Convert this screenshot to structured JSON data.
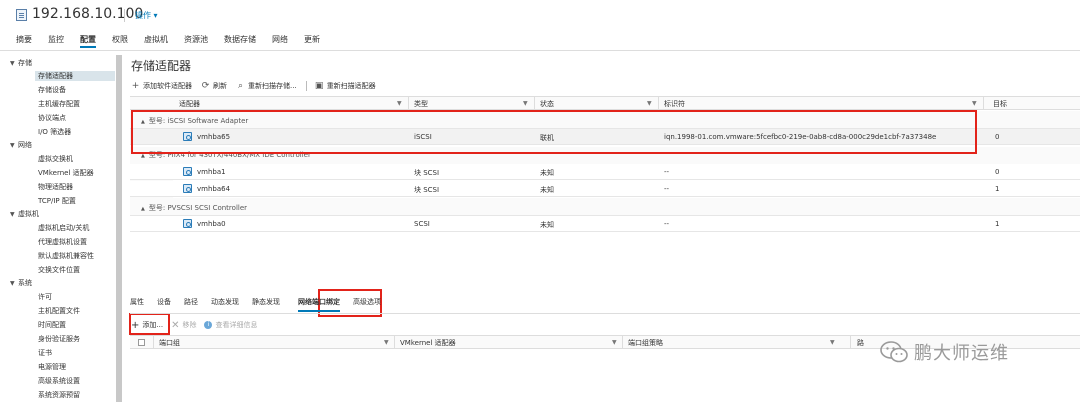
{
  "header": {
    "host": "192.168.10.100",
    "actions_label": "操作 ▾",
    "tabs": [
      "摘要",
      "监控",
      "配置",
      "权限",
      "虚拟机",
      "资源池",
      "数据存储",
      "网络",
      "更新"
    ],
    "active_tab": "配置"
  },
  "sidebar": {
    "groups": [
      {
        "label": "存储",
        "items": [
          "存储适配器",
          "存储设备",
          "主机缓存配置",
          "协议端点",
          "I/O 筛选器"
        ]
      },
      {
        "label": "网络",
        "items": [
          "虚拟交换机",
          "VMkernel 适配器",
          "物理适配器",
          "TCP/IP 配置"
        ]
      },
      {
        "label": "虚拟机",
        "items": [
          "虚拟机启动/关机",
          "代理虚拟机设置",
          "默认虚拟机兼容性",
          "交换文件位置"
        ]
      },
      {
        "label": "系统",
        "items": [
          "许可",
          "主机配置文件",
          "时间配置",
          "身份验证服务",
          "证书",
          "电源管理",
          "高级系统设置",
          "系统资源预留"
        ]
      }
    ],
    "selected": "存储适配器"
  },
  "main": {
    "title": "存储适配器",
    "toolbar": {
      "add_software": "添加软件适配器",
      "refresh": "刷新",
      "rescan_storage": "重新扫描存储...",
      "rescan_adapter": "重新扫描适配器"
    },
    "columns": [
      "适配器",
      "类型",
      "状态",
      "标识符",
      "目标"
    ],
    "groups": [
      {
        "label": "型号: iSCSI Software Adapter",
        "rows": [
          {
            "adapter": "vmhba65",
            "type": "iSCSI",
            "status": "联机",
            "identifier": "iqn.1998-01.com.vmware:5fcefbc0-219e-0ab8-cd8a-000c29de1cbf-7a37348e",
            "targets": "0"
          }
        ]
      },
      {
        "label": "型号: PIIX4 for 430TX/440BX/MX IDE Controller",
        "rows": [
          {
            "adapter": "vmhba1",
            "type": "块 SCSI",
            "status": "未知",
            "identifier": "--",
            "targets": "0"
          },
          {
            "adapter": "vmhba64",
            "type": "块 SCSI",
            "status": "未知",
            "identifier": "--",
            "targets": "1"
          }
        ]
      },
      {
        "label": "型号: PVSCSI SCSI Controller",
        "rows": [
          {
            "adapter": "vmhba0",
            "type": "SCSI",
            "status": "未知",
            "identifier": "--",
            "targets": "1"
          }
        ]
      }
    ]
  },
  "details": {
    "tabs": [
      "属性",
      "设备",
      "路径",
      "动态发现",
      "静态发现",
      "网络端口绑定",
      "高级选项"
    ],
    "active_tab": "网络端口绑定",
    "toolbar": {
      "add": "添加...",
      "remove": "移除",
      "view_details": "查看详细信息"
    },
    "columns": [
      "端口组",
      "VMkernel 适配器",
      "端口组策略",
      "路"
    ]
  },
  "watermark": {
    "text": "鹏大师运维"
  },
  "colors": {
    "accent": "#0079b8",
    "highlight": "#e2231a"
  }
}
